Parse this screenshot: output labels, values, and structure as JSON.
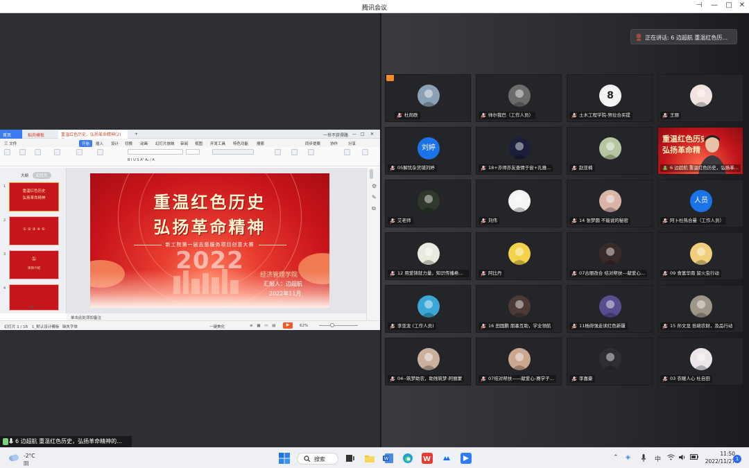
{
  "window": {
    "title": "腾讯会议"
  },
  "speaking": {
    "label": "正在讲话: 6 边超航 重温红色历..."
  },
  "wps": {
    "tabs": {
      "home": "首页",
      "docer": "稻壳模板",
      "doc": "重温红色历史、弘扬革命精神(2) ◎",
      "user": "一世不获得路"
    },
    "ribbon_tabs": [
      "三 文件",
      "开始",
      "插入",
      "设计",
      "切换",
      "动画",
      "幻灯片放映",
      "审阅",
      "视图",
      "开发工具",
      "特色功能",
      "搜索"
    ],
    "ribbon_active": "开始",
    "ribbon_right": [
      "同步提案",
      "协作",
      "分享"
    ],
    "panel_tabs": {
      "outline": "大纲",
      "slides": "幻灯片"
    },
    "thumbs": [
      {
        "num": "1",
        "text1": "重温红色历史",
        "text2": "弘扬革命精神"
      },
      {
        "num": "2",
        "text1": "① ② ③ ④ ⑤",
        "text2": ""
      },
      {
        "num": "3",
        "text1": "①",
        "text2": "项目介绍"
      },
      {
        "num": "4",
        "text1": "",
        "text2": ""
      }
    ],
    "slide": {
      "title1": "重温红色历史",
      "title2": "弘扬革命精神",
      "subtitle": "新工院第一届志愿服务项目创意大赛",
      "year": "2022",
      "org": "经济管理学院",
      "reporter": "汇报人：边超航",
      "date": "2022年11月"
    },
    "notes": "单击此处添加备注",
    "status": {
      "slide": "幻灯片 1 / 16",
      "theme": "1_默认设计模板",
      "font": "缺失字体",
      "beautify": "一键美化",
      "zoom": "62%"
    }
  },
  "participants": [
    {
      "name": "杜尚欧",
      "avatar_color": "#8aa0b4",
      "host": true
    },
    {
      "name": "帅尔我巴（工作人员）",
      "avatar_color": "#6b6b6b",
      "host": false
    },
    {
      "name": "土木工程学院-努拉合买提",
      "avatar_color": "#f4f4f4",
      "avatar_text": "8",
      "host": false
    },
    {
      "name": "王丽",
      "avatar_color": "#f1e3e0",
      "host": false
    },
    {
      "name": "05解忧杂货铺刘婷",
      "avatar_color": "#1a73e8",
      "avatar_text": "刘婷",
      "host": false
    },
    {
      "name": "18+亦师亦友查情于尝+孔雅...",
      "avatar_color": "#1b1f3a",
      "host": false
    },
    {
      "name": "赵亚楠",
      "avatar_color": "#b5c7a1",
      "host": false
    },
    {
      "name": "6 边超航 重温红色历史，弘扬革...",
      "avatar_color": "#c4161c",
      "host": false,
      "video": true
    },
    {
      "name": "艾老师",
      "avatar_color": "#2f3a2a",
      "host": false
    },
    {
      "name": "刘伟",
      "avatar_color": "#f5f5f5",
      "host": false
    },
    {
      "name": "14 张梦圆 不能说的秘密",
      "avatar_color": "#d8b5a8",
      "host": false
    },
    {
      "name": "阿卜杜热合曼（工作人员）",
      "avatar_color": "#1a73e8",
      "avatar_text": "人员",
      "host": false
    },
    {
      "name": "12 用爱铸就力量，知识传播希望...",
      "avatar_color": "#e8ecdf",
      "host": false
    },
    {
      "name": "阿比丹",
      "avatar_color": "#f2d24a",
      "host": false
    },
    {
      "name": "07古丽孜合 结对帮扶---献爱心...",
      "avatar_color": "#3a2b2b",
      "host": false
    },
    {
      "name": "09 食富华南 留火虫行动",
      "avatar_color": "#f1cf7a",
      "host": false
    },
    {
      "name": "李亚龙 (工作人员)",
      "avatar_color": "#3aa7d6",
      "host": false
    },
    {
      "name": "16 田国鹏 朋墨互助，学业领航",
      "avatar_color": "#4b3a36",
      "host": false
    },
    {
      "name": "11杨府强走读红色新疆",
      "avatar_color": "#5a4d8f",
      "host": false
    },
    {
      "name": "15 孙文龙 拾疏农财，及品行动",
      "avatar_color": "#9e9789",
      "host": false
    },
    {
      "name": "04--筑梦助农，助残筑梦-阿丽蒙",
      "avatar_color": "#c9b19e",
      "host": false
    },
    {
      "name": "07结对帮扶——献爱心-赛学子...",
      "avatar_color": "#caa78d",
      "host": false
    },
    {
      "name": "李嘉豪",
      "avatar_color": "#2f2f33",
      "host": false
    },
    {
      "name": "03 衣暖人心 杜自田",
      "avatar_color": "#ece6ea",
      "host": false
    }
  ],
  "caption": "6 边超航 重温红色历史，弘扬革命精神的...",
  "taskbar": {
    "temp": "-2°C",
    "condition": "阴",
    "search": "搜索",
    "ime": "中",
    "time": "11:50",
    "date": "2022/11/27",
    "notif_count": "1"
  }
}
